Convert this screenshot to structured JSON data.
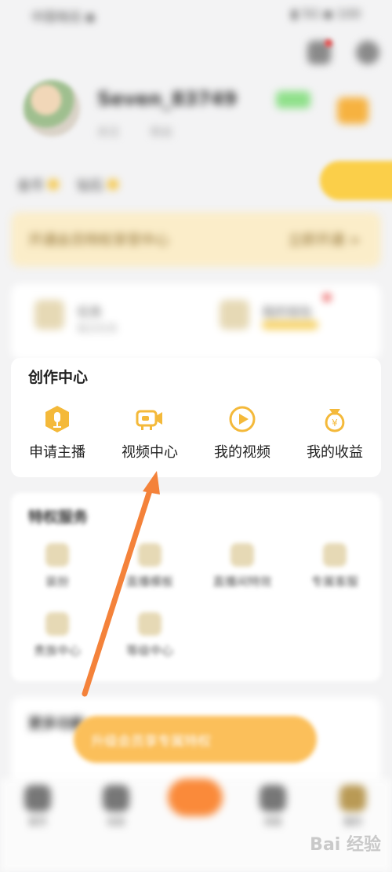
{
  "status": {
    "left": "中国电信 ◾",
    "right": "▮ 5G ◾ 100"
  },
  "profile": {
    "username": "Seven_83749",
    "sub1": "关注",
    "sub2": "粉丝"
  },
  "stats": [
    {
      "label": "金币"
    },
    {
      "label": "钻石"
    }
  ],
  "vip_banner": {
    "text": "开通会员特权享受中心",
    "action": "立即开通 >"
  },
  "top_cards": [
    {
      "title": "任务",
      "sub": "每日任务"
    },
    {
      "title": "我的钱包"
    }
  ],
  "creation_center": {
    "title": "创作中心",
    "items": [
      {
        "label": "申请主播",
        "icon": "anchor-badge-icon"
      },
      {
        "label": "视频中心",
        "icon": "video-camera-icon"
      },
      {
        "label": "我的视频",
        "icon": "play-circle-icon"
      },
      {
        "label": "我的收益",
        "icon": "money-bag-icon"
      }
    ]
  },
  "privilege_services": {
    "title": "特权服务",
    "items": [
      {
        "label": "装扮"
      },
      {
        "label": "直播模板"
      },
      {
        "label": "直播间特效"
      },
      {
        "label": "专属客服"
      },
      {
        "label": "贵族中心"
      },
      {
        "label": "等级中心"
      }
    ]
  },
  "more_section": {
    "title": "更多功能"
  },
  "toast": {
    "text": "升级会员享专属特权"
  },
  "nav": {
    "items": [
      {
        "label": "首页"
      },
      {
        "label": "动态"
      },
      {
        "label": "消息"
      },
      {
        "label": "我的"
      }
    ]
  },
  "watermark": "Bai 经验",
  "colors": {
    "accent": "#f4b93a",
    "arrow": "#f4823a",
    "background": "#f3f3f4"
  }
}
